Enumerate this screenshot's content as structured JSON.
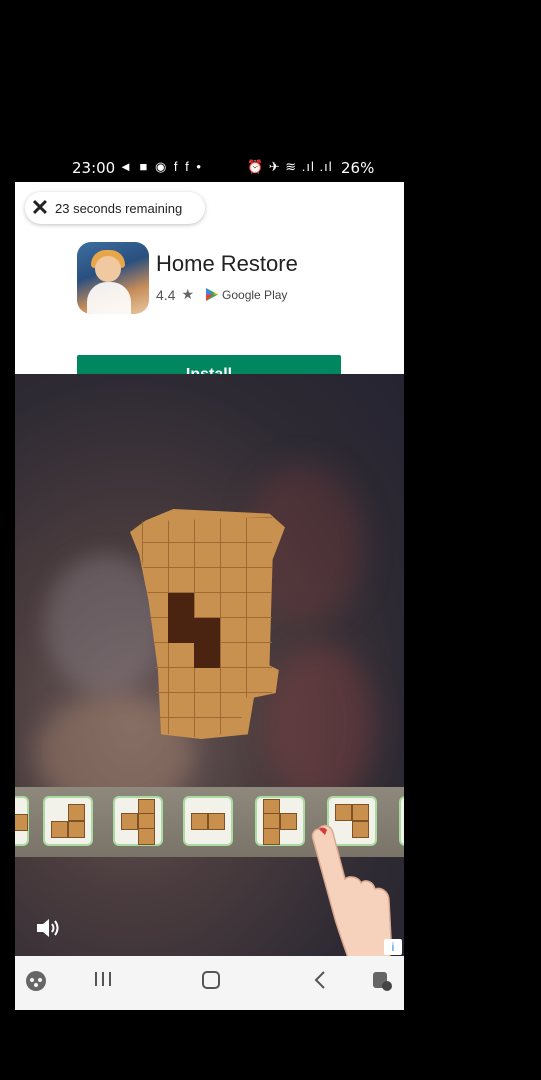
{
  "status_bar": {
    "time": "23:00",
    "left_icons": "◄ ■ ◉ f f •",
    "right_icons": "⏰ ✈ ≋ .ıl .ıl",
    "battery": "26%"
  },
  "ad": {
    "timer_text": "23 seconds remaining",
    "app_name": "Home Restore",
    "rating": "4.4",
    "store_label": "Google Play",
    "install_label": "Install"
  },
  "game": {
    "ad_badge": "i"
  },
  "colors": {
    "install_green": "#01875f",
    "wood": "#c8914f",
    "wood_dark": "#4a2410"
  }
}
